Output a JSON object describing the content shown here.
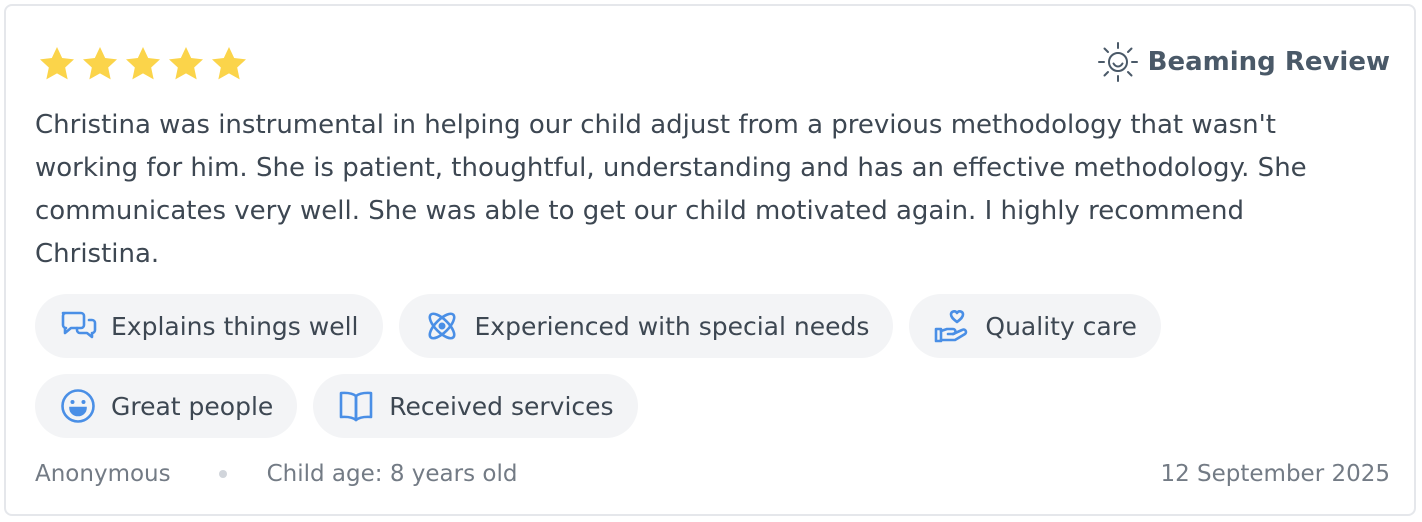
{
  "review": {
    "rating": 5,
    "max_rating": 5,
    "star_color": "#fbd44a",
    "badge": {
      "icon": "sun-smile-icon",
      "label": "Beaming Review"
    },
    "text": "Christina was instrumental in helping our child adjust from a previous methodology that wasn't working for him. She is patient, thoughtful, understanding and has an effective methodology. She communicates very well. She was able to get our child motivated again. I highly recommend Christina.",
    "tags": [
      {
        "icon": "chat-bubbles-icon",
        "label": "Explains things well"
      },
      {
        "icon": "atom-icon",
        "label": "Experienced with special needs"
      },
      {
        "icon": "hand-heart-icon",
        "label": "Quality care"
      },
      {
        "icon": "smiley-face-icon",
        "label": "Great people"
      },
      {
        "icon": "open-book-icon",
        "label": "Received services"
      }
    ],
    "tag_icon_color": "#4a8fe6",
    "author": "Anonymous",
    "child_age": "Child age: 8 years old",
    "date": "12 September 2025"
  }
}
